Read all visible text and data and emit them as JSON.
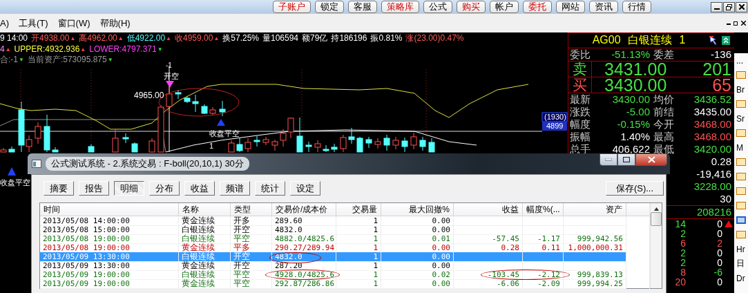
{
  "top_toolbar": {
    "buttons": [
      {
        "label": "子账户",
        "highlighted": true
      },
      {
        "label": "锁定",
        "highlighted": false
      },
      {
        "label": "客服",
        "highlighted": false
      },
      {
        "label": "策略库",
        "highlighted": true
      },
      {
        "label": "公式",
        "highlighted": false
      },
      {
        "label": "购买",
        "highlighted": true
      },
      {
        "label": "帐户",
        "highlighted": false
      },
      {
        "label": "委托",
        "highlighted": true
      },
      {
        "label": "网站",
        "highlighted": false
      },
      {
        "label": "资讯",
        "highlighted": false
      },
      {
        "label": "行情",
        "highlighted": false
      }
    ]
  },
  "menu_bar": {
    "items": [
      "A)",
      "工具(T)",
      "窗口(W)",
      "帮助(H)"
    ]
  },
  "chart": {
    "info_lines": [
      [
        {
          "text": "9 14:00",
          "color": "#ffffff"
        },
        {
          "text": "开4938.00",
          "color": "#ff5a5a",
          "arrow": {
            "text": "▲",
            "color": "#ff4040"
          }
        },
        {
          "text": "高4962.00",
          "color": "#ff5a5a",
          "arrow": {
            "text": "▲",
            "color": "#ff4040"
          }
        },
        {
          "text": "低4922.00",
          "color": "#54ffff",
          "arrow": {
            "text": "▲",
            "color": "#ff4040"
          }
        },
        {
          "text": "收4959.00",
          "color": "#ff5a5a",
          "arrow": {
            "text": "▲",
            "color": "#ff4040"
          }
        },
        {
          "text": "换57.25%",
          "color": "#ffffff"
        },
        {
          "text": "量106594",
          "color": "#ffffff"
        },
        {
          "text": "额79亿",
          "color": "#ffffff"
        },
        {
          "text": "持186196",
          "color": "#ffffff"
        },
        {
          "text": "振0.81%",
          "color": "#ffffff"
        },
        {
          "text": "涨(23.00)0.47%",
          "color": "#ff5a5a"
        }
      ],
      [
        {
          "text": "4",
          "color": "#ff80ff",
          "arrow": {
            "text": "▲",
            "color": "#ff4040"
          }
        },
        {
          "text": "UPPER:4932.936",
          "color": "#ffff40",
          "arrow": {
            "text": "▲",
            "color": "#ff4040"
          }
        },
        {
          "text": "LOWER:4797.371",
          "color": "#ff40ff",
          "arrow": {
            "text": "▼",
            "color": "#30e030"
          }
        }
      ],
      [
        {
          "text": "合:-1",
          "color": "#9a9a9a",
          "arrow": {
            "text": "▼",
            "color": "#30e030"
          }
        },
        {
          "text": "当前资产:573095.875",
          "color": "#9a9a9a",
          "arrow": {
            "text": "▼",
            "color": "#30e030"
          }
        }
      ]
    ],
    "labels": [
      "-1",
      "开空",
      "4965.00",
      "收盘平空",
      "1",
      "收盘平空"
    ],
    "price_tag": {
      "bracket": "(1930)",
      "price": "4899"
    }
  },
  "quote": {
    "title": "AG00 白银连续 1",
    "sections": [
      [
        {
          "kind": "pair",
          "cells": [
            {
              "text": "委比"
            },
            {
              "text": "-51.13%",
              "color": "#44e044"
            },
            {
              "text": "委差"
            },
            {
              "text": "-136",
              "color": "#ffffff"
            }
          ]
        }
      ],
      [
        {
          "kind": "big",
          "cells": [
            {
              "text": "卖",
              "color": "#44e044"
            },
            {
              "text": "3431.00",
              "color": "#44e044"
            },
            {
              "text": "201",
              "color": "#44e044"
            }
          ]
        }
      ],
      [
        {
          "kind": "big",
          "cells": [
            {
              "text": "买",
              "color": "#ff5050"
            },
            {
              "text": "3430.00",
              "color": "#44e044"
            },
            {
              "text": "65",
              "color": "#ff5050"
            }
          ]
        }
      ],
      [
        {
          "kind": "pair",
          "cells": [
            {
              "text": "最新"
            },
            {
              "text": "3430.00",
              "color": "#44e044"
            },
            {
              "text": "均价"
            },
            {
              "text": "3436.52",
              "color": "#44e044"
            }
          ]
        },
        {
          "kind": "pair",
          "cells": [
            {
              "text": "涨跌"
            },
            {
              "text": "-5.00",
              "color": "#44e044"
            },
            {
              "text": "前结"
            },
            {
              "text": "3435.00",
              "color": "#ffffff"
            }
          ]
        },
        {
          "kind": "pair",
          "cells": [
            {
              "text": "幅度"
            },
            {
              "text": "-0.15%",
              "color": "#44e044"
            },
            {
              "text": "今开"
            },
            {
              "text": "3468.00",
              "color": "#ff5050"
            }
          ]
        },
        {
          "kind": "pair",
          "cells": [
            {
              "text": "振幅"
            },
            {
              "text": "1.40%",
              "color": "#ffffff"
            },
            {
              "text": "最高"
            },
            {
              "text": "3468.00",
              "color": "#ff5050"
            }
          ]
        },
        {
          "kind": "pair",
          "cells": [
            {
              "text": "总手"
            },
            {
              "text": "406,622",
              "color": "#ffffff"
            },
            {
              "text": "最低"
            },
            {
              "text": "3420.00",
              "color": "#44e044"
            }
          ]
        },
        {
          "kind": "single",
          "cells": [
            {
              "text": "0.28",
              "color": "#ffffff"
            }
          ]
        },
        {
          "kind": "single",
          "cells": [
            {
              "text": "-19,416",
              "color": "#ffffff"
            }
          ]
        },
        {
          "kind": "single",
          "cells": [
            {
              "text": "3228.00",
              "color": "#44e044"
            }
          ]
        },
        {
          "kind": "single",
          "cells": [
            {
              "text": "30",
              "color": "#ffffff"
            }
          ]
        }
      ],
      [
        {
          "kind": "single",
          "cells": [
            {
              "text": "208216",
              "color": "#44e044"
            }
          ]
        }
      ]
    ],
    "ticks": [
      {
        "count": {
          "text": "14",
          "color": "#44e044"
        },
        "change": {
          "text": "0",
          "color": "#ffffff"
        },
        "flag": true
      },
      {
        "count": {
          "text": "2",
          "color": "#44e044"
        },
        "change": {
          "text": "0",
          "color": "#ffffff"
        },
        "flag": false
      },
      {
        "count": {
          "text": "6",
          "color": "#ff5050"
        },
        "change": {
          "text": "2",
          "color": "#ff5050"
        },
        "flag": false
      },
      {
        "count": {
          "text": "2",
          "color": "#44e044"
        },
        "change": {
          "text": "0",
          "color": "#ffffff"
        },
        "flag": false
      },
      {
        "count": {
          "text": "2",
          "color": "#44e044"
        },
        "change": {
          "text": "0",
          "color": "#ffffff"
        },
        "flag": false
      },
      {
        "count": {
          "text": "8",
          "color": "#ff5050"
        },
        "change": {
          "text": "-6",
          "color": "#44e044"
        },
        "flag": false
      },
      {
        "count": {
          "text": "20",
          "color": "#ff5050"
        },
        "change": {
          "text": "0",
          "color": "#ffffff"
        },
        "flag": false
      }
    ]
  },
  "side_toolbar": {
    "items": [
      {
        "kind": "text",
        "text": "...",
        "selected": false
      },
      {
        "kind": "icon",
        "selected": false
      },
      {
        "kind": "text",
        "text": "Br",
        "selected": false
      },
      {
        "kind": "icon",
        "selected": false
      },
      {
        "kind": "text",
        "text": "Sr",
        "selected": false
      },
      {
        "kind": "icon",
        "selected": false
      },
      {
        "kind": "text",
        "text": "M",
        "selected": false
      },
      {
        "kind": "icon",
        "selected": false
      },
      {
        "kind": "icon",
        "selected": false
      },
      {
        "kind": "icon",
        "selected": false
      },
      {
        "kind": "icon",
        "selected": false
      },
      {
        "kind": "icon",
        "selected": true
      },
      {
        "kind": "icon",
        "selected": false
      },
      {
        "kind": "text",
        "text": "Hr",
        "selected": false
      },
      {
        "kind": "text",
        "text": "日",
        "selected": false
      },
      {
        "kind": "text",
        "text": "Dr",
        "selected": false
      }
    ]
  },
  "dialog": {
    "title": "公式测试系统 - 2.系统交易 : F-boll(20,10,1) 30分",
    "tabs": [
      {
        "label": "摘要",
        "selected": false
      },
      {
        "label": "报告",
        "selected": false
      },
      {
        "label": "明细",
        "selected": true
      },
      {
        "label": "分布",
        "selected": false
      },
      {
        "label": "收益",
        "selected": false
      },
      {
        "label": "频谱",
        "selected": false
      },
      {
        "label": "统计",
        "selected": false
      },
      {
        "label": "设定",
        "selected": false
      }
    ],
    "save_button": "保存(S)...",
    "table": {
      "columns": [
        "时间",
        "名称",
        "类型",
        "交易价/成本价",
        "交易量",
        "最大回撤%",
        "收益",
        "幅度%(...",
        "资产"
      ],
      "rows": [
        {
          "cells": [
            "2013/05/08 14:00:00",
            "黄金连续",
            "开多",
            "289.60",
            "1",
            "0.00",
            "",
            "",
            ""
          ],
          "color": "#000000",
          "selected": false
        },
        {
          "cells": [
            "2013/05/08 15:00:00",
            "白银连续",
            "开空",
            "4832.0",
            "1",
            "0.00",
            "",
            "",
            ""
          ],
          "color": "#000000",
          "selected": false
        },
        {
          "cells": [
            "2013/05/08 19:00:00",
            "白银连续",
            "平空",
            "4882.0/4825.6",
            "1",
            "0.01",
            "-57.45",
            "-1.17",
            "999,942.56"
          ],
          "color": "#107010",
          "selected": false
        },
        {
          "cells": [
            "2013/05/08 19:00:00",
            "黄金连续",
            "平多",
            "290.27/289.94",
            "1",
            "0.00",
            "0.28",
            "0.11",
            "1,000,000.31"
          ],
          "color": "#c00000",
          "selected": false
        },
        {
          "cells": [
            "2013/05/09 13:30:00",
            "白银连续",
            "开空",
            "4832.0",
            "1",
            "0.00",
            "",
            "",
            ""
          ],
          "color": "#ffffff",
          "selected": true
        },
        {
          "cells": [
            "2013/05/09 13:30:00",
            "黄金连续",
            "开空",
            "287.20",
            "1",
            "0.00",
            "",
            "",
            ""
          ],
          "color": "#000000",
          "selected": false
        },
        {
          "cells": [
            "2013/05/09 19:00:00",
            "白银连续",
            "平空",
            "4928.0/4825.6",
            "1",
            "0.02",
            "-103.45",
            "-2.12",
            "999,839.13"
          ],
          "color": "#107010",
          "selected": false
        },
        {
          "cells": [
            "2013/05/09 19:00:00",
            "黄金连续",
            "平空",
            "292.87/286.86",
            "1",
            "0.00",
            "-6.06",
            "-2.09",
            "999,994.25"
          ],
          "color": "#107010",
          "selected": false
        }
      ]
    }
  }
}
